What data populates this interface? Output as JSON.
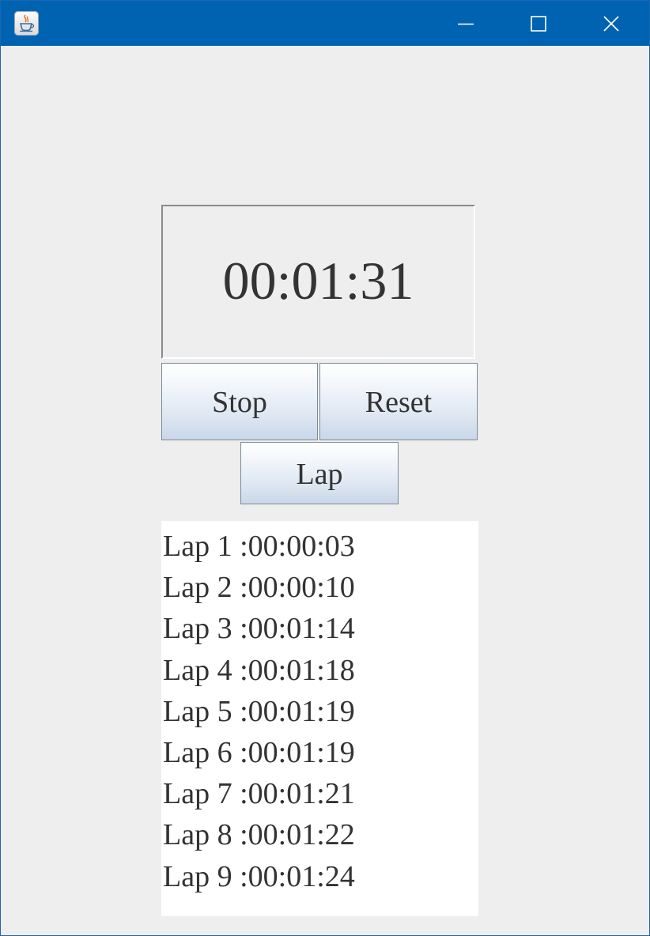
{
  "window": {
    "icon": "java-cup-icon",
    "controls": [
      "minimize-icon",
      "maximize-icon",
      "close-icon"
    ]
  },
  "timer": {
    "display": "00:01:31"
  },
  "buttons": {
    "stop": "Stop",
    "reset": "Reset",
    "lap": "Lap"
  },
  "laps": [
    "Lap 1 :00:00:03",
    "Lap 2 :00:00:10",
    "Lap 3 :00:01:14",
    "Lap 4 :00:01:18",
    "Lap 5 :00:01:19",
    "Lap 6 :00:01:19",
    "Lap 7 :00:01:21",
    "Lap 8 :00:01:22",
    "Lap 9 :00:01:24"
  ],
  "colors": {
    "titlebar": "#0063b1",
    "window_bg": "#eeeeee",
    "text": "#333333"
  }
}
